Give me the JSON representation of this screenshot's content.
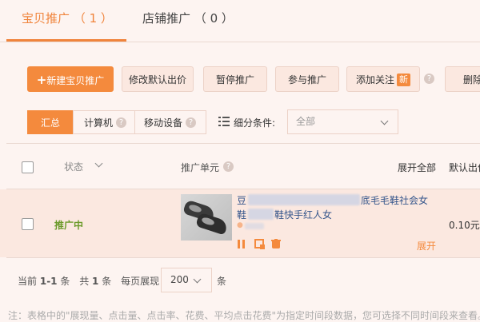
{
  "tabs": [
    {
      "label": "宝贝推广",
      "count": "（ 1 ）"
    },
    {
      "label": "店铺推广",
      "count": "（ 0 ）"
    }
  ],
  "toolbar": {
    "new_label": "新建宝贝推广",
    "modify_bid": "修改默认出价",
    "pause": "暂停推广",
    "join": "参与推广",
    "follow": "添加关注",
    "new_badge": "新",
    "delete": "删除"
  },
  "segments": [
    "汇总",
    "计算机",
    "移动设备"
  ],
  "filter": {
    "label": "细分条件:",
    "value": "全部"
  },
  "table": {
    "col_status": "状态",
    "col_unit": "推广单元",
    "expand_all": "展开全部",
    "col_bid": "默认出价"
  },
  "row": {
    "status": "推广中",
    "title_start": "豆",
    "title_end": "底毛毛鞋社会女",
    "title2_start": "鞋",
    "title2_end": "鞋快手红人女",
    "dot": "●",
    "bid": "0.10元",
    "expand": "展开"
  },
  "pager": {
    "current_pre": "当前",
    "current_range": "1-1",
    "current_post": "条",
    "total_pre": "共",
    "total": "1",
    "total_post": "条",
    "per_page_label": "每页展现",
    "per_page": "200",
    "unit": "条"
  },
  "note": "注：表格中的\"展现量、点击量、点击率、花费、平均点击花费\"为指定时间段数据，您可选择不同时间段来查看。"
}
